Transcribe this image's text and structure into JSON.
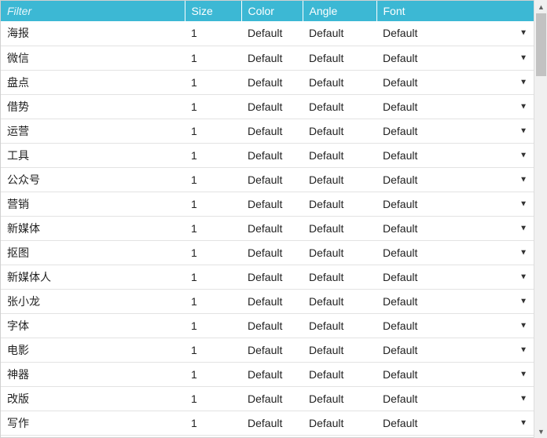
{
  "columns": {
    "filter_placeholder": "Filter",
    "size": "Size",
    "color": "Color",
    "angle": "Angle",
    "font": "Font"
  },
  "default_label": "Default",
  "rows": [
    {
      "term": "海报",
      "size": "1",
      "color": "Default",
      "angle": "Default",
      "font": "Default"
    },
    {
      "term": "微信",
      "size": "1",
      "color": "Default",
      "angle": "Default",
      "font": "Default"
    },
    {
      "term": "盘点",
      "size": "1",
      "color": "Default",
      "angle": "Default",
      "font": "Default"
    },
    {
      "term": "借势",
      "size": "1",
      "color": "Default",
      "angle": "Default",
      "font": "Default"
    },
    {
      "term": "运营",
      "size": "1",
      "color": "Default",
      "angle": "Default",
      "font": "Default"
    },
    {
      "term": "工具",
      "size": "1",
      "color": "Default",
      "angle": "Default",
      "font": "Default"
    },
    {
      "term": "公众号",
      "size": "1",
      "color": "Default",
      "angle": "Default",
      "font": "Default"
    },
    {
      "term": "营销",
      "size": "1",
      "color": "Default",
      "angle": "Default",
      "font": "Default"
    },
    {
      "term": "新媒体",
      "size": "1",
      "color": "Default",
      "angle": "Default",
      "font": "Default"
    },
    {
      "term": "抠图",
      "size": "1",
      "color": "Default",
      "angle": "Default",
      "font": "Default"
    },
    {
      "term": "新媒体人",
      "size": "1",
      "color": "Default",
      "angle": "Default",
      "font": "Default"
    },
    {
      "term": "张小龙",
      "size": "1",
      "color": "Default",
      "angle": "Default",
      "font": "Default"
    },
    {
      "term": "字体",
      "size": "1",
      "color": "Default",
      "angle": "Default",
      "font": "Default"
    },
    {
      "term": "电影",
      "size": "1",
      "color": "Default",
      "angle": "Default",
      "font": "Default"
    },
    {
      "term": "神器",
      "size": "1",
      "color": "Default",
      "angle": "Default",
      "font": "Default"
    },
    {
      "term": "改版",
      "size": "1",
      "color": "Default",
      "angle": "Default",
      "font": "Default"
    },
    {
      "term": "写作",
      "size": "1",
      "color": "Default",
      "angle": "Default",
      "font": "Default"
    }
  ]
}
